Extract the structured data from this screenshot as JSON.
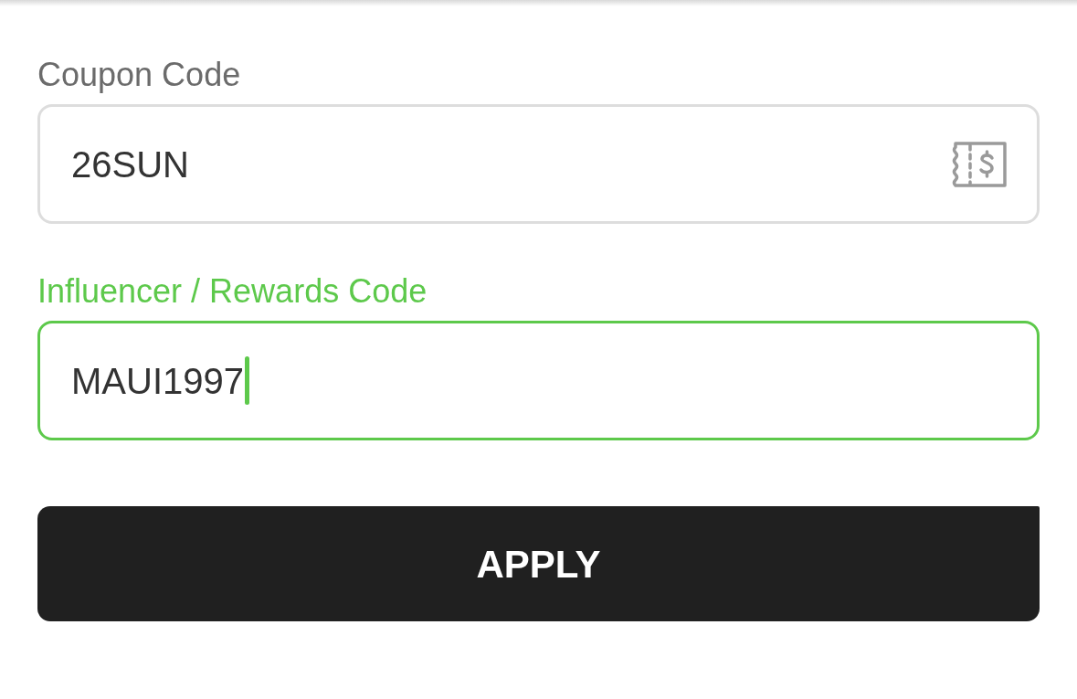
{
  "fields": [
    {
      "kind": "coupon",
      "label": "Coupon Code",
      "value": "26SUN",
      "focused": false
    },
    {
      "kind": "plain",
      "label": "Influencer / Rewards Code",
      "value": "MAUI1997",
      "focused": true
    }
  ],
  "apply_button": {
    "label": "APPLY"
  }
}
